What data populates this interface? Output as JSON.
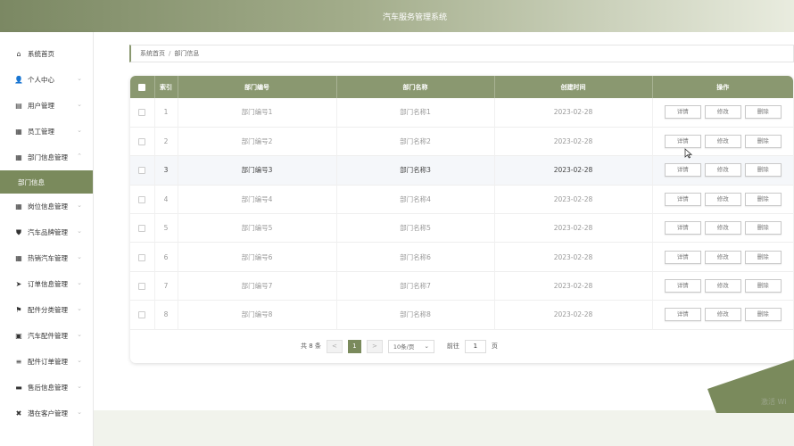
{
  "app": {
    "title": "汽车服务管理系统"
  },
  "sidebar": {
    "items": [
      {
        "label": "系统首页",
        "icon": "home-icon",
        "glyph": "⌂",
        "has_chevron": false
      },
      {
        "label": "个人中心",
        "icon": "user-icon",
        "glyph": "👤",
        "has_chevron": true
      },
      {
        "label": "用户管理",
        "icon": "notebook-icon",
        "glyph": "▤",
        "has_chevron": true
      },
      {
        "label": "员工管理",
        "icon": "grid-icon",
        "glyph": "▦",
        "has_chevron": true
      },
      {
        "label": "部门信息管理",
        "icon": "grid-icon",
        "glyph": "▦",
        "has_chevron": true,
        "expanded": true
      },
      {
        "label": "岗位信息管理",
        "icon": "grid-icon",
        "glyph": "▦",
        "has_chevron": true
      },
      {
        "label": "汽车品牌管理",
        "icon": "shield-icon",
        "glyph": "⛊",
        "has_chevron": true
      },
      {
        "label": "热销汽车管理",
        "icon": "grid-icon",
        "glyph": "▦",
        "has_chevron": true
      },
      {
        "label": "订单信息管理",
        "icon": "send-icon",
        "glyph": "➤",
        "has_chevron": true
      },
      {
        "label": "配件分类管理",
        "icon": "flag-icon",
        "glyph": "⚑",
        "has_chevron": true
      },
      {
        "label": "汽车配件管理",
        "icon": "image-icon",
        "glyph": "▣",
        "has_chevron": true
      },
      {
        "label": "配件订单管理",
        "icon": "list-icon",
        "glyph": "≡",
        "has_chevron": true
      },
      {
        "label": "售后信息管理",
        "icon": "chat-icon",
        "glyph": "▬",
        "has_chevron": true
      },
      {
        "label": "潜在客户管理",
        "icon": "shuffle-icon",
        "glyph": "✖",
        "has_chevron": true
      }
    ],
    "active_sub": "部门信息"
  },
  "breadcrumb": {
    "home": "系统首页",
    "separator": "/",
    "current": "部门信息"
  },
  "table": {
    "columns": [
      "索引",
      "部门编号",
      "部门名称",
      "创建时间",
      "操作"
    ],
    "rows": [
      {
        "index": "1",
        "code": "部门编号1",
        "name": "部门名称1",
        "date": "2023-02-28"
      },
      {
        "index": "2",
        "code": "部门编号2",
        "name": "部门名称2",
        "date": "2023-02-28"
      },
      {
        "index": "3",
        "code": "部门编号3",
        "name": "部门名称3",
        "date": "2023-02-28"
      },
      {
        "index": "4",
        "code": "部门编号4",
        "name": "部门名称4",
        "date": "2023-02-28"
      },
      {
        "index": "5",
        "code": "部门编号5",
        "name": "部门名称5",
        "date": "2023-02-28"
      },
      {
        "index": "6",
        "code": "部门编号6",
        "name": "部门名称6",
        "date": "2023-02-28"
      },
      {
        "index": "7",
        "code": "部门编号7",
        "name": "部门名称7",
        "date": "2023-02-28"
      },
      {
        "index": "8",
        "code": "部门编号8",
        "name": "部门名称8",
        "date": "2023-02-28"
      }
    ],
    "actions": {
      "detail": "详情",
      "edit": "修改",
      "delete": "删除"
    },
    "hover_row": 2
  },
  "pagination": {
    "total": "共 8 条",
    "prev": "<",
    "current_page": "1",
    "next": ">",
    "page_size": "10条/页",
    "goto_label": "前往",
    "goto_value": "1",
    "page_suffix": "页"
  },
  "watermark": "激活 Wi",
  "colors": {
    "accent": "#8a9870",
    "active": "#7a8a5c"
  }
}
